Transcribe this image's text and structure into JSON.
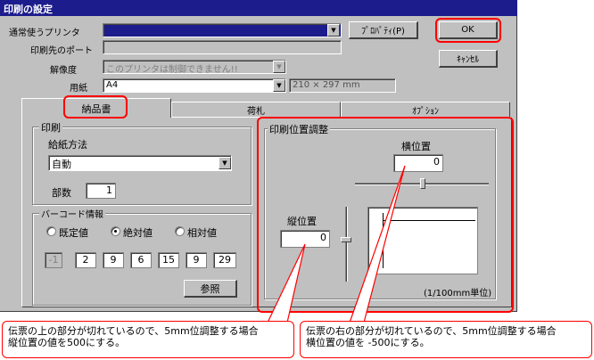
{
  "window": {
    "title": "印刷の設定"
  },
  "printer": {
    "label": "通常使うプリンタ",
    "selected": "",
    "properties_button": "ﾌﾟﾛﾊﾟﾃｨ(P)"
  },
  "port": {
    "label": "印刷先のポート",
    "value": ""
  },
  "resolution": {
    "label": "解像度",
    "value": "このプリンタは制御できません!!"
  },
  "paper": {
    "label": "用紙",
    "value": "A4",
    "size_text": "210 × 297 mm"
  },
  "buttons": {
    "ok": "OK",
    "cancel": "ｷｬﾝｾﾙ",
    "browse": "参照"
  },
  "tabs": [
    "納品書",
    "荷札",
    "ｵﾌﾟｼｮﾝ"
  ],
  "print_group": {
    "title": "印刷",
    "feed_label": "給紙方法",
    "feed_value": "自動",
    "copies_label": "部数",
    "copies_value": "1"
  },
  "barcode_group": {
    "title": "バーコード情報",
    "radios": [
      {
        "label": "既定値",
        "checked": false
      },
      {
        "label": "絶対値",
        "checked": true
      },
      {
        "label": "相対値",
        "checked": false
      }
    ],
    "fields": [
      "-1",
      "2",
      "9",
      "6",
      "15",
      "9",
      "29"
    ]
  },
  "position_group": {
    "title": "印刷位置調整",
    "horizontal_label": "横位置",
    "horizontal_value": "0",
    "vertical_label": "縦位置",
    "vertical_value": "0",
    "unit_note": "(1/100mm単位)"
  },
  "callouts": {
    "left": "伝票の上の部分が切れているので、5mm位調整する場合\n縦位置の値を500にする。",
    "right": "伝票の右の部分が切れているので、5mm位調整する場合\n横位置の値を -500にする。"
  },
  "colors": {
    "highlight": "#ff0000",
    "title_bar": "#1c1c8c",
    "face": "#c0c0c0"
  }
}
